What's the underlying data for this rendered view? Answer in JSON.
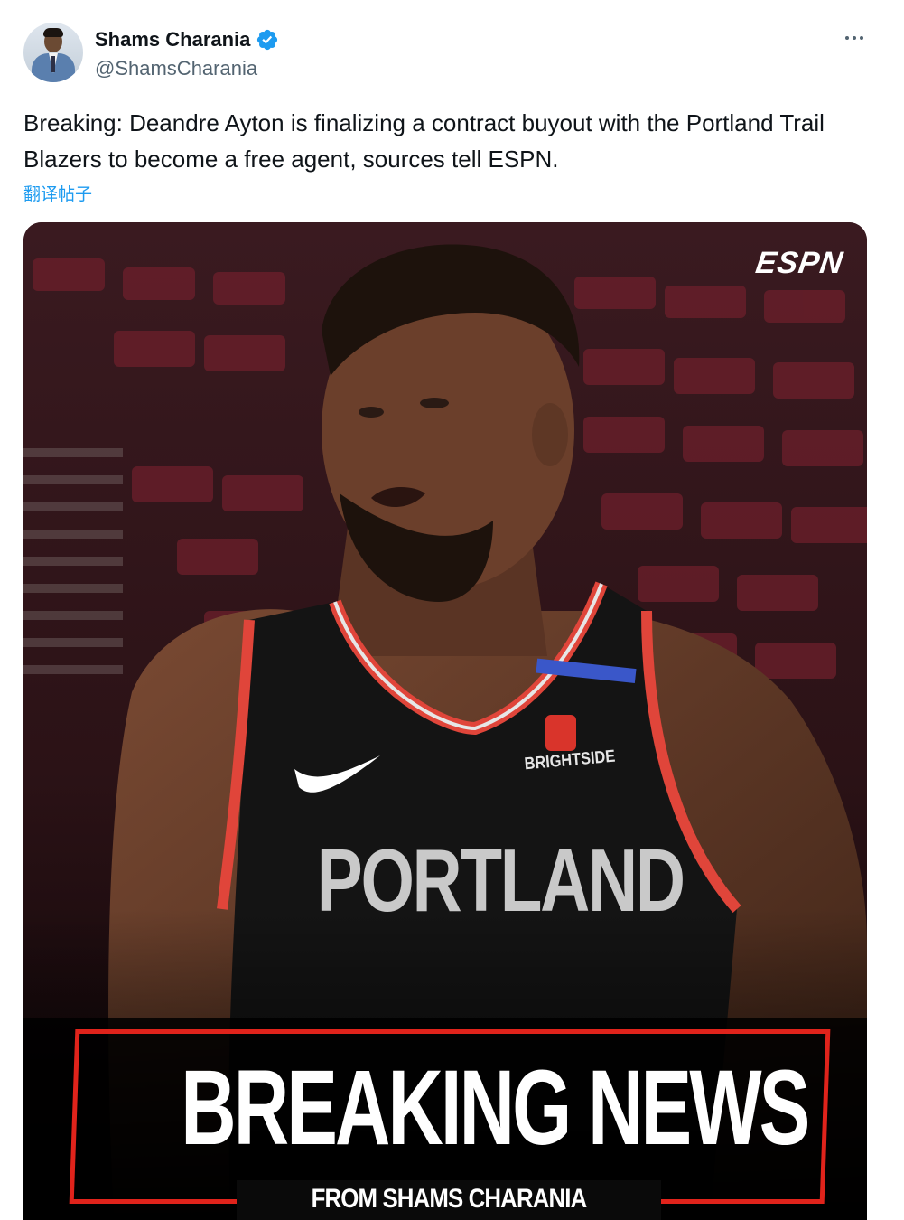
{
  "tweet": {
    "author_name": "Shams Charania",
    "author_handle": "@ShamsCharania",
    "text": "Breaking: Deandre Ayton is finalizing a contract buyout with the Portland Trail Blazers to become a free agent, sources tell ESPN.",
    "translate_label": "翻译帖子"
  },
  "media": {
    "logo_text": "ESPN",
    "jersey_text": "PORTLAND",
    "sponsor_text": "BRIGHTSIDE",
    "headline": "BREAKING NEWS",
    "subline": "FROM SHAMS CHARANIA"
  },
  "colors": {
    "verified_badge": "#1d9bf0",
    "translate_link": "#1d9bf0",
    "breaking_red": "#e0231b",
    "jersey_trim": "#e0453a"
  },
  "icons": {
    "verified": "verified-badge-icon",
    "more": "more-options-icon"
  }
}
